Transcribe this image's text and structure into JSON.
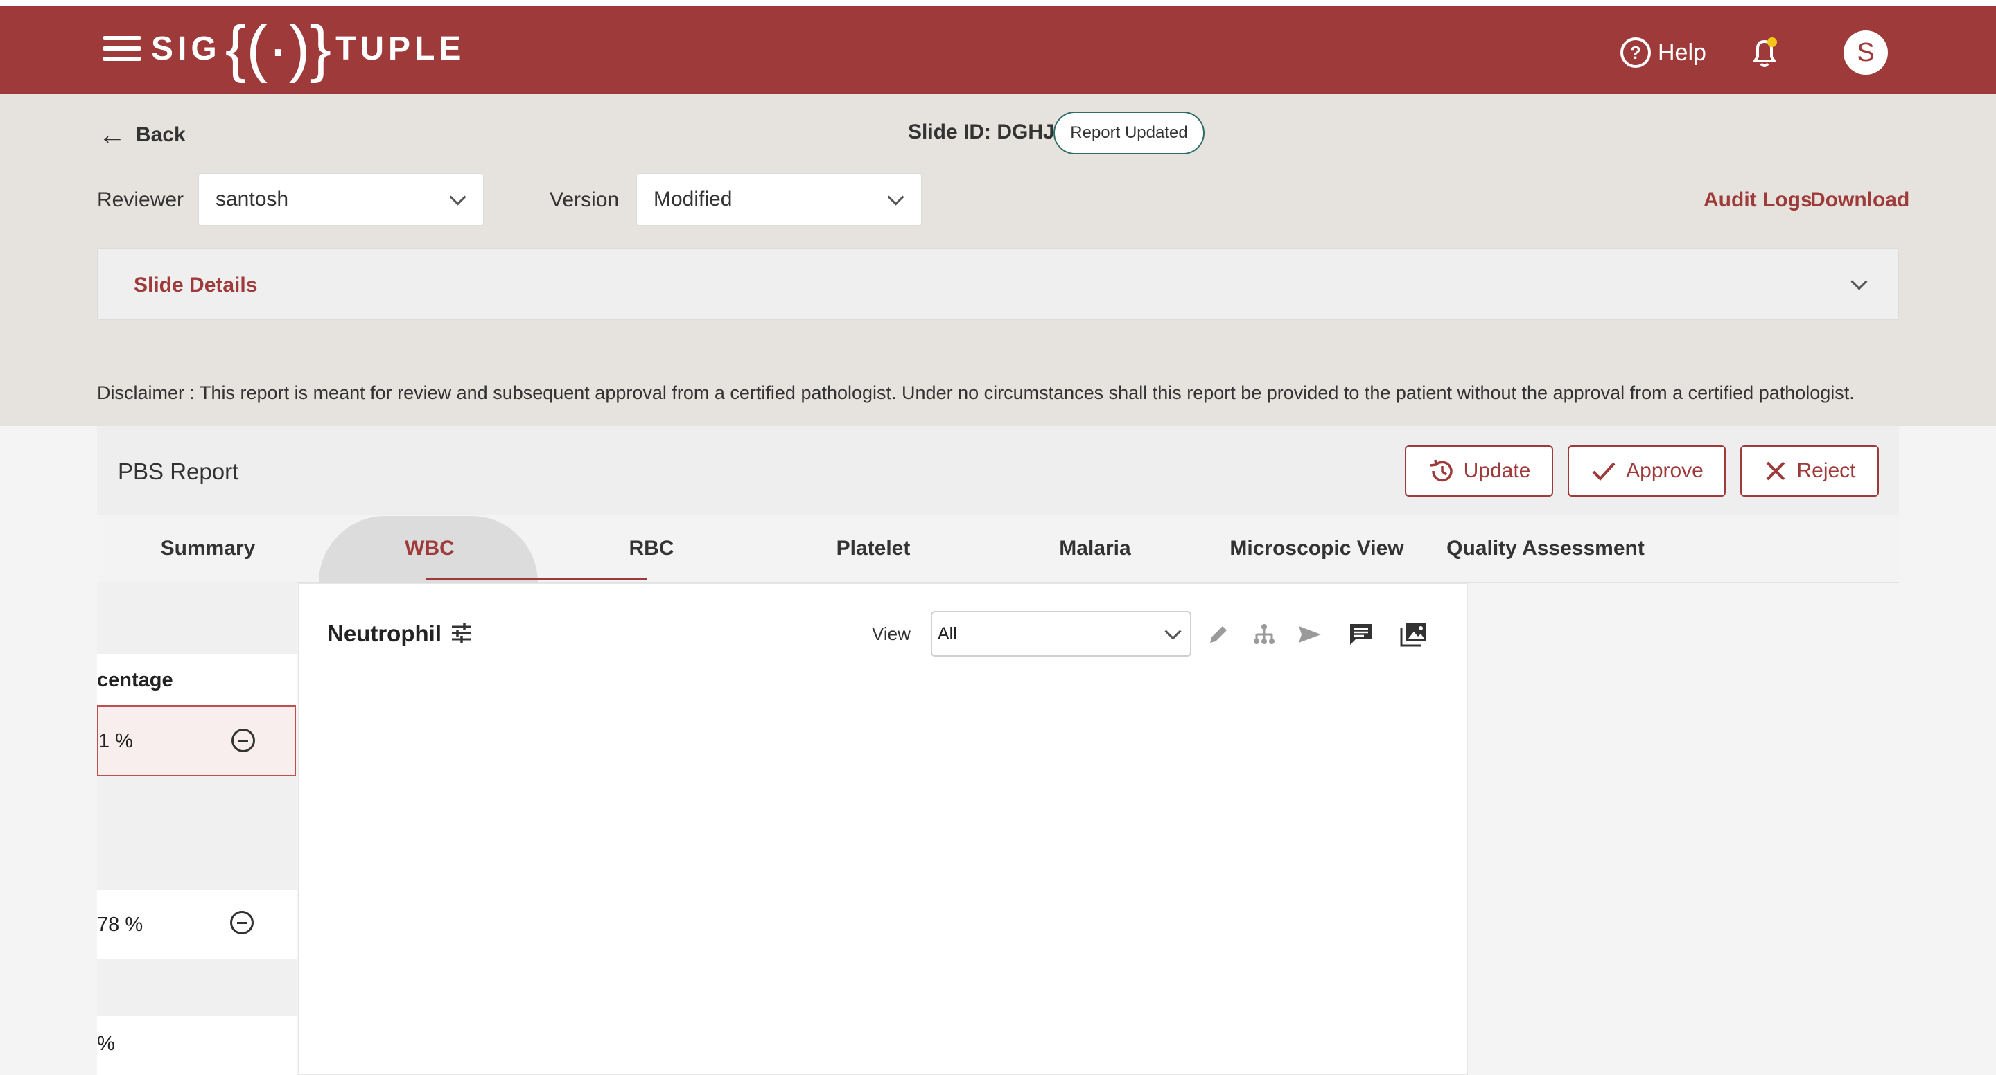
{
  "header": {
    "logo_left": "SIG",
    "logo_braces": "{(·)}",
    "logo_right": "TUPLE",
    "help_label": "Help",
    "avatar_initial": "S"
  },
  "nav": {
    "back_label": "Back",
    "slide_id": "Slide ID: DGHJ",
    "status_badge": "Report Updated"
  },
  "filters": {
    "reviewer_label": "Reviewer",
    "reviewer_value": "santosh",
    "version_label": "Version",
    "version_value": "Modified",
    "audit_logs": "Audit Logs",
    "download": "Download"
  },
  "slide_details": {
    "title": "Slide Details"
  },
  "disclaimer": "Disclaimer :  This report is meant for review and subsequent approval from a certified pathologist. Under no circumstances shall this report be provided to the patient without the approval from a certified pathologist.",
  "report": {
    "title": "PBS Report",
    "actions": {
      "update": "Update",
      "approve": "Approve",
      "reject": "Reject"
    },
    "tabs": [
      "Summary",
      "WBC",
      "RBC",
      "Platelet",
      "Malaria",
      "Microscopic View",
      "Quality Assessment"
    ],
    "active_tab": "WBC"
  },
  "left_panel": {
    "column_header": "centage",
    "rows": [
      "1 %",
      "78 %",
      "%"
    ]
  },
  "cell_panel": {
    "title": "Neutrophil",
    "view_label": "View",
    "view_value": "All",
    "tools": [
      "pencil-icon",
      "hierarchy-icon",
      "send-icon",
      "comment-icon",
      "image-gallery-icon"
    ]
  },
  "colors": {
    "brand": "#9e3a3a",
    "badge_border": "#2e6e67",
    "panel_bg": "#e6e3de"
  }
}
